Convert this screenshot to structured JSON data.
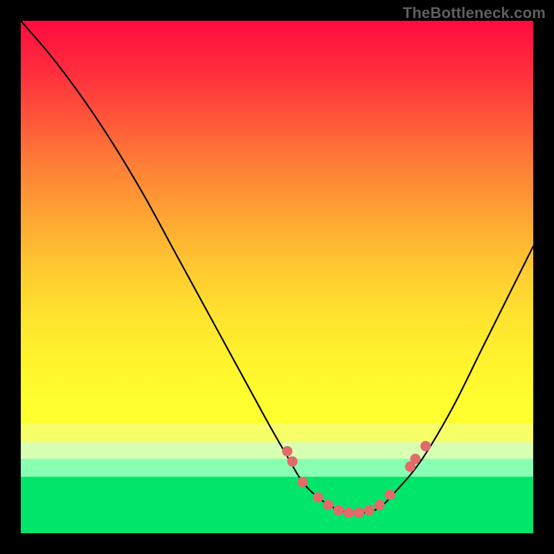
{
  "watermark": "TheBottleneck.com",
  "chart_data": {
    "type": "line",
    "title": "",
    "xlabel": "",
    "ylabel": "",
    "xlim": [
      0,
      100
    ],
    "ylim": [
      0,
      100
    ],
    "series": [
      {
        "name": "curve",
        "x": [
          0,
          6,
          12,
          18,
          24,
          30,
          36,
          42,
          48,
          52,
          55,
          58,
          61,
          64,
          67,
          70,
          73,
          78,
          84,
          90,
          96,
          100
        ],
        "values": [
          100,
          93,
          85,
          76,
          66,
          55,
          44,
          33,
          22,
          15,
          10,
          7,
          5,
          4,
          4,
          5,
          8,
          14,
          24,
          36,
          48,
          56
        ]
      }
    ],
    "markers": [
      {
        "x": 52,
        "y": 16
      },
      {
        "x": 53,
        "y": 14
      },
      {
        "x": 55,
        "y": 10
      },
      {
        "x": 58,
        "y": 7
      },
      {
        "x": 60,
        "y": 5.5
      },
      {
        "x": 62,
        "y": 4.5
      },
      {
        "x": 64,
        "y": 4
      },
      {
        "x": 66,
        "y": 4
      },
      {
        "x": 68,
        "y": 4.5
      },
      {
        "x": 70,
        "y": 5.5
      },
      {
        "x": 72,
        "y": 7.5
      },
      {
        "x": 76,
        "y": 13
      },
      {
        "x": 77,
        "y": 14.5
      },
      {
        "x": 79,
        "y": 17
      }
    ],
    "marker_color": "#e26a6a",
    "gradient_stops": [
      {
        "pos": 0.0,
        "color": "#ff0b3f"
      },
      {
        "pos": 0.5,
        "color": "#ffcf30"
      },
      {
        "pos": 0.78,
        "color": "#feff2f"
      },
      {
        "pos": 0.82,
        "color": "#f7ff68"
      },
      {
        "pos": 0.86,
        "color": "#d9ffb3"
      },
      {
        "pos": 0.89,
        "color": "#88ffb3"
      },
      {
        "pos": 1.0,
        "color": "#00e56a"
      }
    ]
  }
}
